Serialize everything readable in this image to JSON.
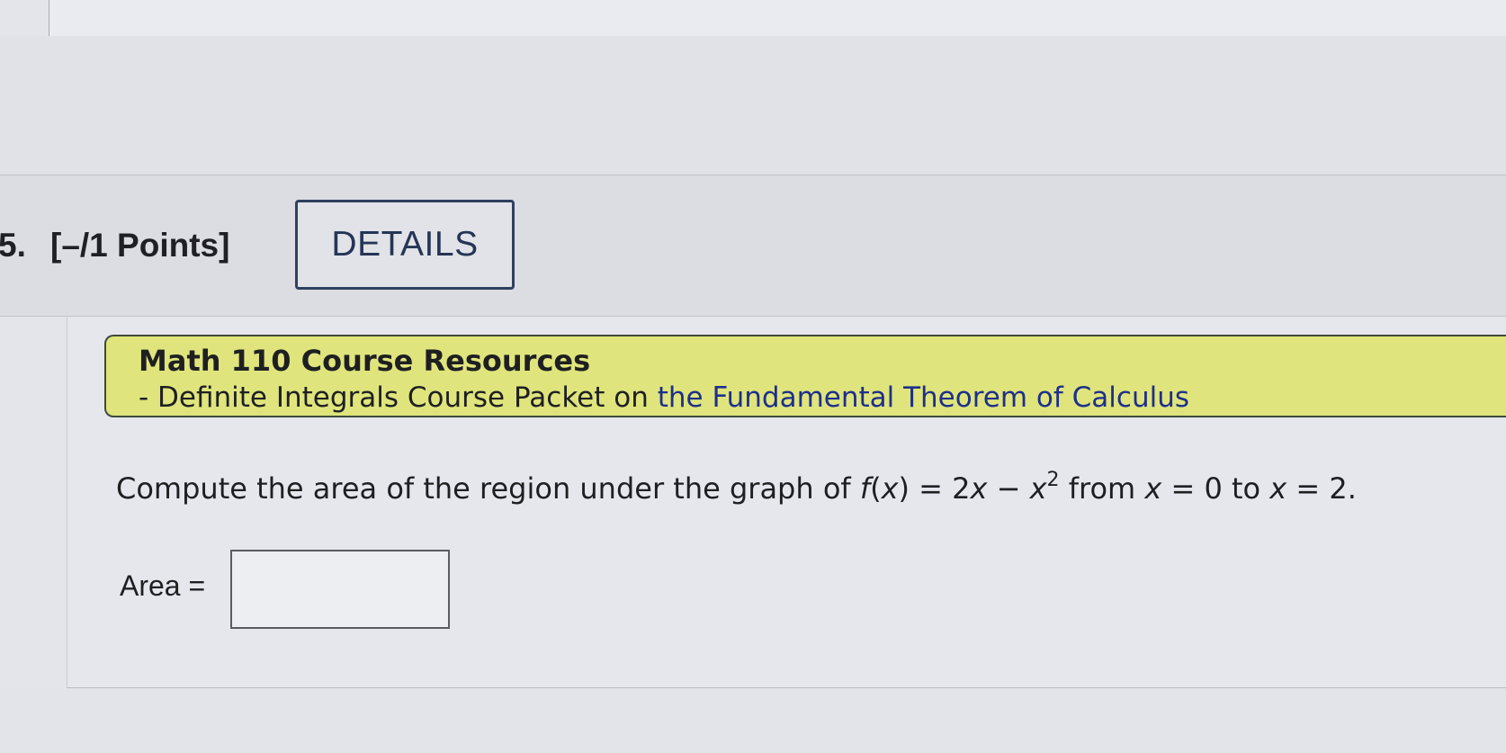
{
  "question": {
    "number": "5.",
    "points": "[–/1 Points]",
    "details_label": "DETAILS"
  },
  "resources": {
    "title": "Math 110 Course Resources",
    "line_prefix": "- Definite Integrals Course Packet on ",
    "link_text": "the Fundamental Theorem of Calculus"
  },
  "prompt": {
    "part1": "Compute the area of the region under the graph of ",
    "fname": "f",
    "part2": "(",
    "var1": "x",
    "part3": ") = 2",
    "var2": "x",
    "part4": " − ",
    "var3": "x",
    "exponent": "2",
    "part5": " from ",
    "var4": "x",
    "part6": " = 0 to ",
    "var5": "x",
    "part7": " = 2."
  },
  "answer": {
    "label": "Area = ",
    "value": ""
  },
  "colors": {
    "resource_highlight": "#dfe57c",
    "link": "#1e2f8a",
    "button_border": "#2f4060"
  }
}
